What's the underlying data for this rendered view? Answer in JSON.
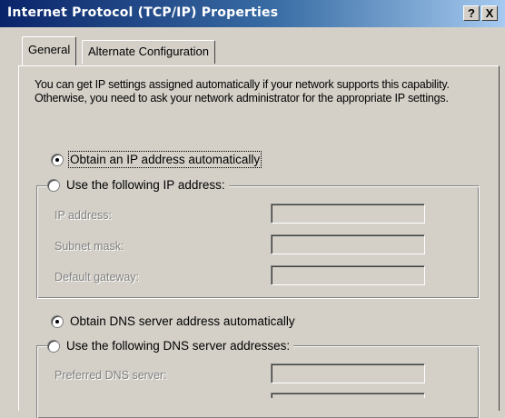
{
  "window": {
    "title": "Internet Protocol (TCP/IP) Properties",
    "help_label": "?",
    "close_label": "X"
  },
  "tabs": [
    {
      "label": "General",
      "selected": true
    },
    {
      "label": "Alternate Configuration",
      "selected": false
    }
  ],
  "description": "You can get IP settings assigned automatically if your network supports this capability. Otherwise, you need to ask your network administrator for the appropriate IP settings.",
  "ip": {
    "auto_label": "Obtain an IP address automatically",
    "auto_selected": true,
    "manual_label": "Use the following IP address:",
    "manual_selected": false,
    "fields": [
      {
        "label": "IP address:",
        "value": ""
      },
      {
        "label": "Subnet mask:",
        "value": ""
      },
      {
        "label": "Default gateway:",
        "value": ""
      }
    ]
  },
  "dns": {
    "auto_label": "Obtain DNS server address automatically",
    "auto_selected": true,
    "manual_label": "Use the following DNS server addresses:",
    "manual_selected": false,
    "fields": [
      {
        "label": "Preferred DNS server:",
        "value": ""
      }
    ]
  },
  "colors": {
    "titlebar_start": "#0a246a",
    "titlebar_end": "#a6caf0",
    "dialog_face": "#d4d0c8",
    "disabled_text": "#808080"
  }
}
